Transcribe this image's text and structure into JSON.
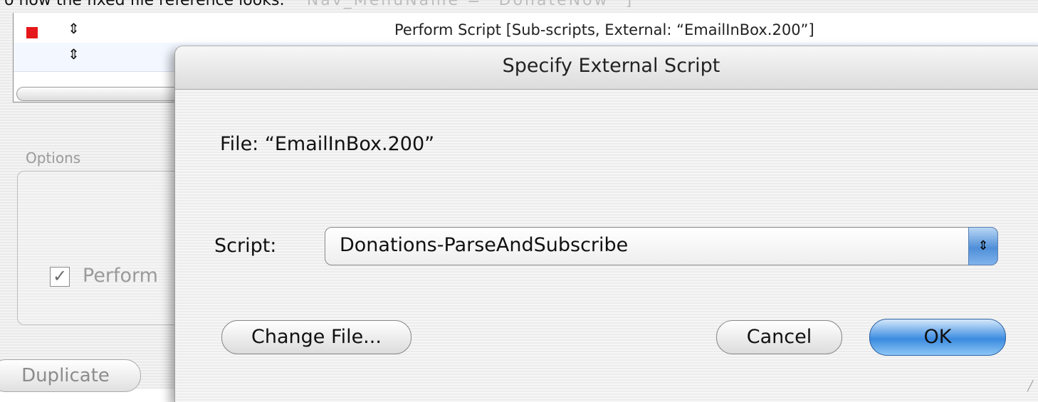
{
  "caption": {
    "text": "o how the fixed file reference looks:",
    "faded_text": "Nav_MenuName = \"DonateNow\" ]"
  },
  "script_list": {
    "rows": [
      {
        "text": "Perform Script [Sub-scripts, External: “EmailInBox.200”]",
        "breakpoint": true
      },
      {
        "text": "",
        "breakpoint": false
      }
    ]
  },
  "options": {
    "label": "Options",
    "perform_checkbox_label": "Perform",
    "perform_checked": true
  },
  "duplicate_button": "Duplicate",
  "dialog": {
    "title": "Specify External Script",
    "file_text": "File: “EmailInBox.200”",
    "script_label": "Script:",
    "script_value": "Donations-ParseAndSubscribe",
    "change_file_button": "Change File...",
    "cancel_button": "Cancel",
    "ok_button": "OK"
  },
  "colors": {
    "breakpoint": "#e5171a",
    "default_button": "#3b8be0"
  }
}
